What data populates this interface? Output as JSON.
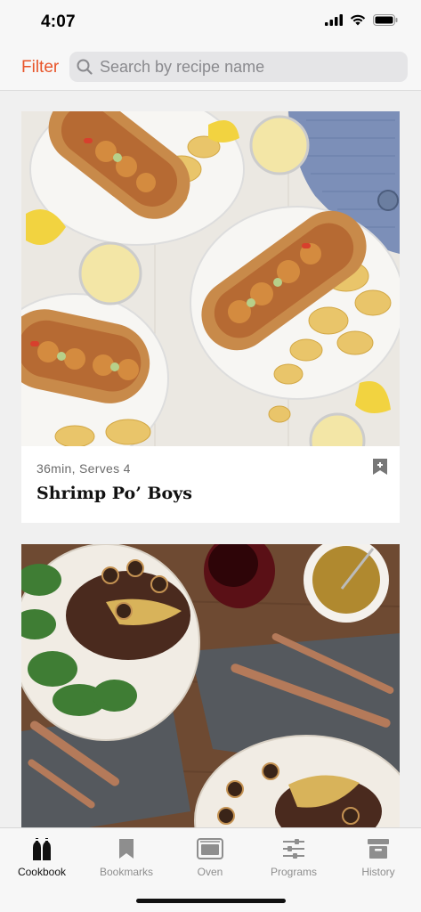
{
  "status_bar": {
    "time": "4:07"
  },
  "header": {
    "filter_label": "Filter",
    "search_placeholder": "Search by recipe name"
  },
  "recipes": [
    {
      "meta": "36min, Serves 4",
      "title": "Shrimp Po’ Boys"
    },
    {
      "meta": "",
      "title": ""
    }
  ],
  "tabs": [
    {
      "label": "Cookbook",
      "icon": "salt-pepper-icon",
      "active": true
    },
    {
      "label": "Bookmarks",
      "icon": "bookmark-icon",
      "active": false
    },
    {
      "label": "Oven",
      "icon": "oven-icon",
      "active": false
    },
    {
      "label": "Programs",
      "icon": "sliders-icon",
      "active": false
    },
    {
      "label": "History",
      "icon": "archive-box-icon",
      "active": false
    }
  ],
  "colors": {
    "accent": "#e8552a",
    "tab_active": "#111111",
    "tab_inactive": "#8e8e8e"
  }
}
